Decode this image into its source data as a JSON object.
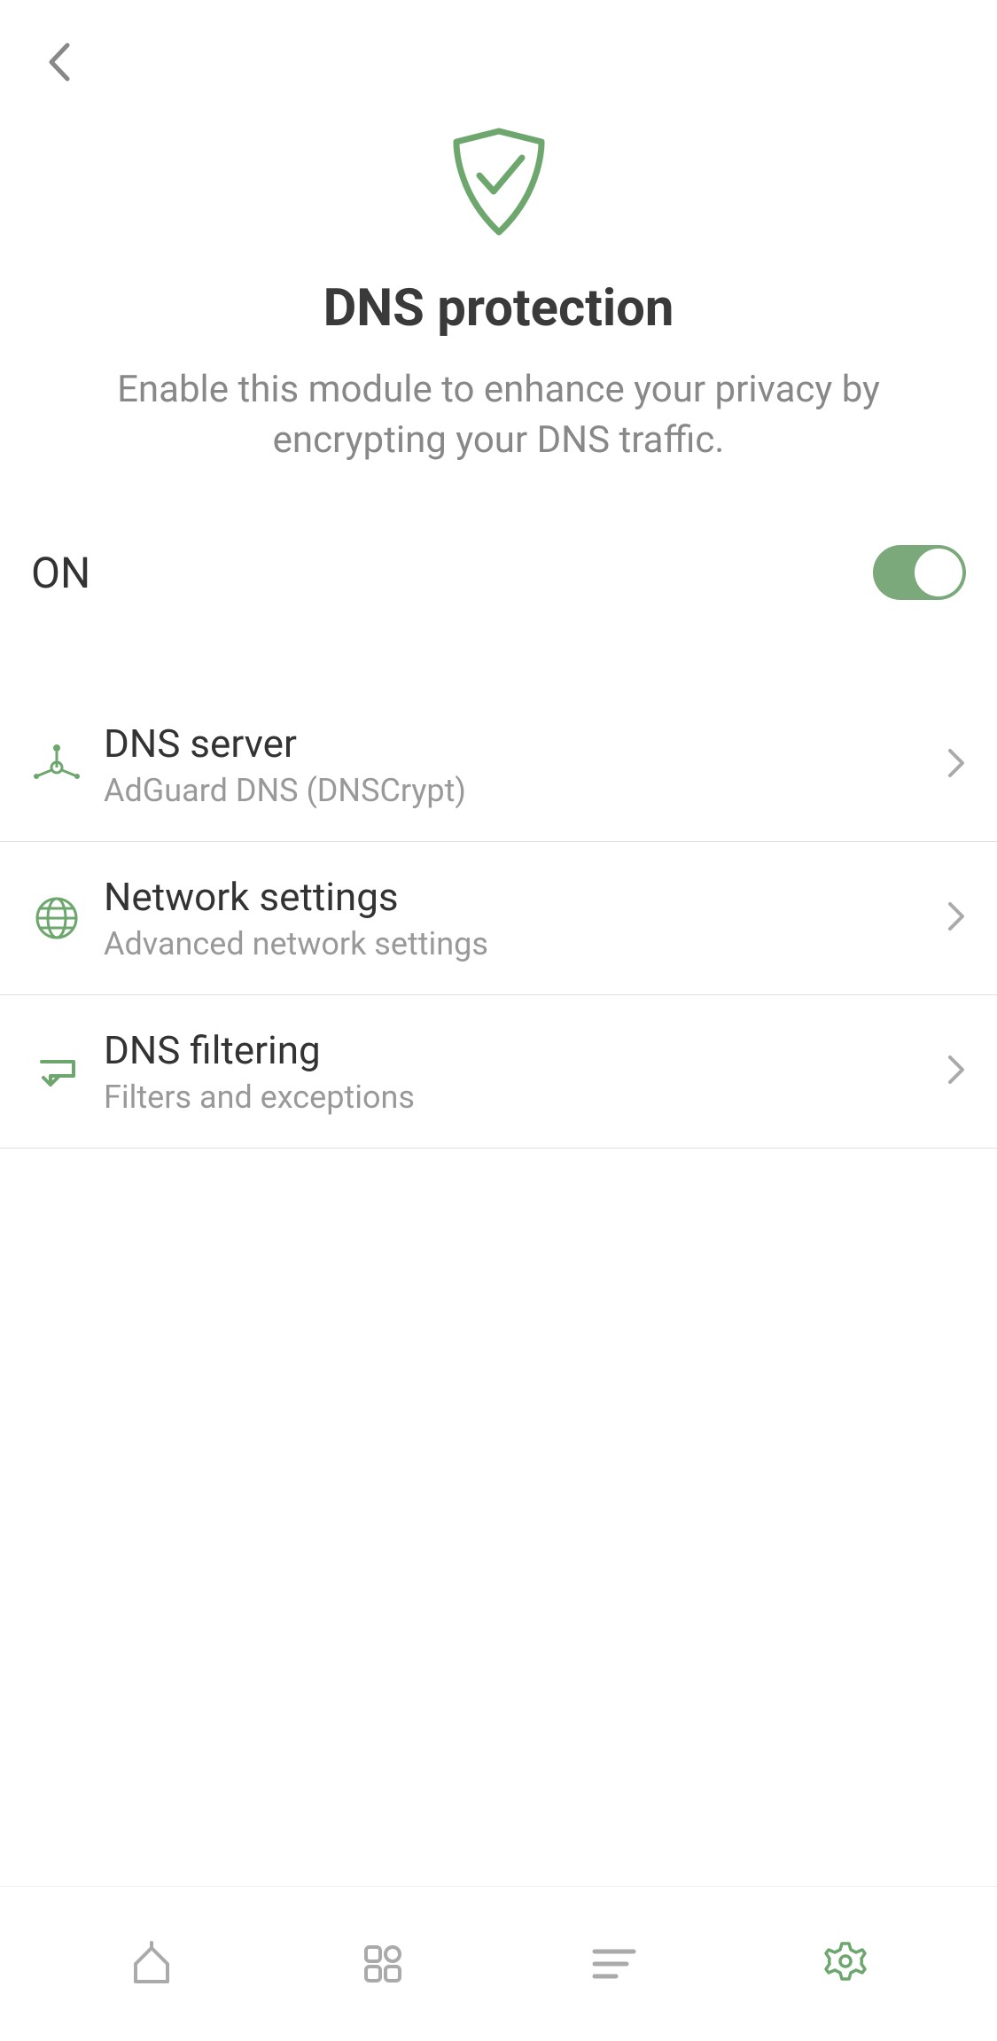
{
  "header": {},
  "hero": {
    "title": "DNS protection",
    "subtitle": "Enable this module to enhance your privacy by encrypting your DNS traffic."
  },
  "toggle": {
    "label": "ON"
  },
  "items": [
    {
      "title": "DNS server",
      "subtitle": "AdGuard DNS (DNSCrypt)"
    },
    {
      "title": "Network settings",
      "subtitle": "Advanced network settings"
    },
    {
      "title": "DNS filtering",
      "subtitle": "Filters and exceptions"
    }
  ],
  "colors": {
    "accent": "#6ea76e",
    "iconGray": "#aaaaaa"
  }
}
